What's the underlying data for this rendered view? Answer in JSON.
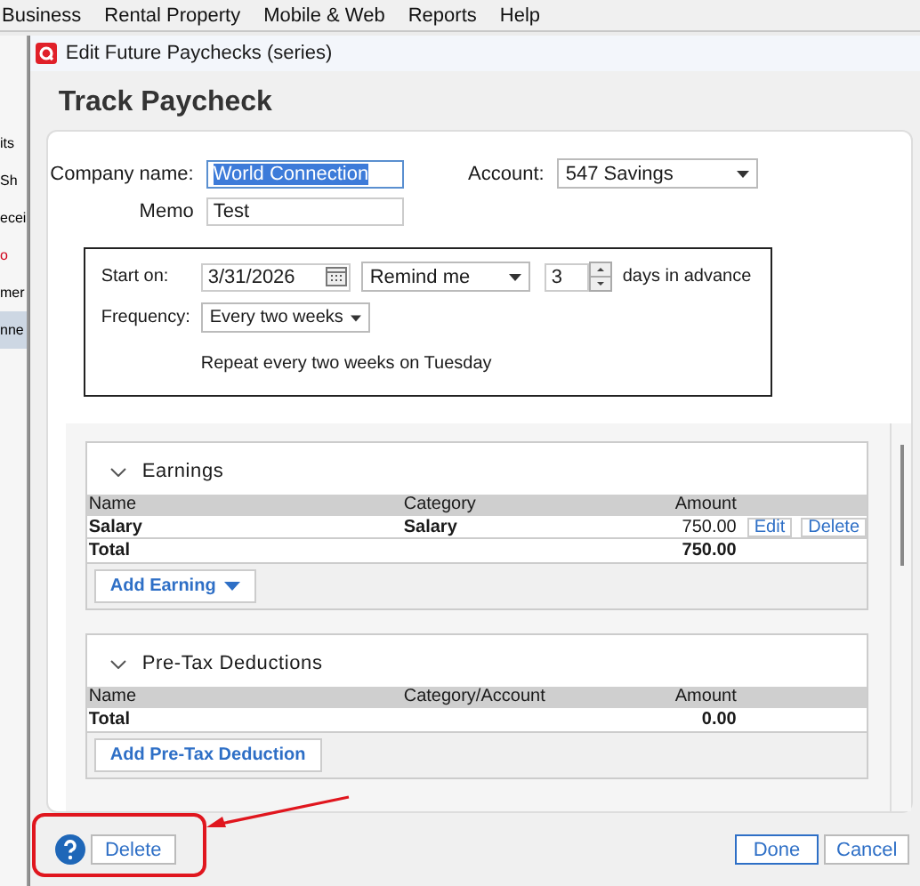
{
  "menu_bar": [
    "Business",
    "Rental Property",
    "Mobile & Web",
    "Reports",
    "Help"
  ],
  "background_fragments": [
    {
      "text": "its",
      "color": "#000000",
      "selected": false
    },
    {
      "text": "Sh",
      "color": "#000000",
      "selected": false
    },
    {
      "text": "ecei",
      "color": "#000000",
      "selected": false
    },
    {
      "text": "o",
      "color": "#d0021b",
      "selected": false
    },
    {
      "text": "mer",
      "color": "#000000",
      "selected": false
    },
    {
      "text": "nne",
      "color": "#000000",
      "selected": true
    }
  ],
  "window": {
    "title": "Edit Future Paychecks (series)"
  },
  "heading": "Track Paycheck",
  "company_name": {
    "label": "Company name:",
    "value": "World Connection",
    "selected": true
  },
  "account": {
    "label": "Account:",
    "value": "547 Savings"
  },
  "memo": {
    "label": "Memo",
    "value": "Test"
  },
  "schedule": {
    "start_label": "Start on:",
    "start_value": "3/31/2026",
    "reminder": "Remind me",
    "days": "3",
    "days_suffix": "days in advance",
    "frequency_label": "Frequency:",
    "frequency_value": "Every two weeks",
    "summary": "Repeat every two weeks on Tuesday"
  },
  "sections": [
    {
      "title": "Earnings",
      "expanded": true,
      "columns": [
        "Name",
        "Category",
        "Amount"
      ],
      "rows": [
        {
          "name": "Salary",
          "category": "Salary",
          "amount": "750.00",
          "actions": [
            "Edit",
            "Delete"
          ]
        }
      ],
      "total": {
        "label": "Total",
        "amount": "750.00"
      },
      "add_button": "Add Earning",
      "add_has_menu": true
    },
    {
      "title": "Pre-Tax Deductions",
      "expanded": true,
      "columns": [
        "Name",
        "Category/Account",
        "Amount"
      ],
      "total": {
        "label": "Total",
        "amount": "0.00"
      },
      "add_button": "Add Pre-Tax Deduction",
      "add_has_menu": false
    }
  ],
  "footer": {
    "delete": "Delete",
    "done": "Done",
    "cancel": "Cancel"
  }
}
